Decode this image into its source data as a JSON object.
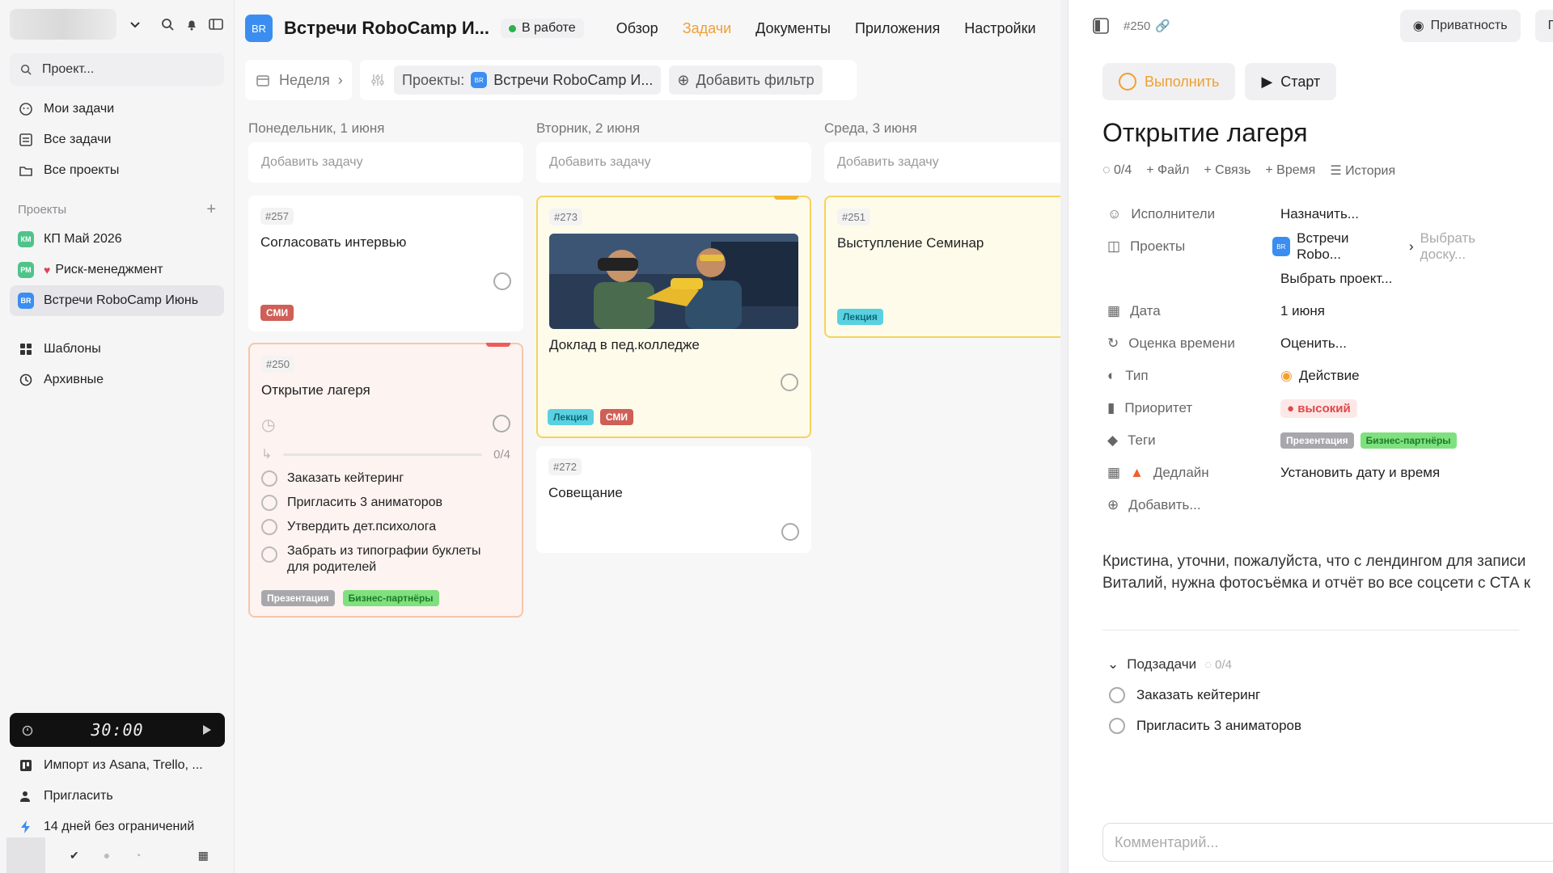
{
  "sidebar": {
    "search_placeholder": "Проект...",
    "nav": [
      {
        "label": "Мои задачи"
      },
      {
        "label": "Все задачи"
      },
      {
        "label": "Все проекты"
      }
    ],
    "projects_header": "Проекты",
    "projects": [
      {
        "badge": "КМ",
        "label": "КП Май 2026",
        "color": "#4fc48a"
      },
      {
        "badge": "РМ",
        "label": "Риск-менеджмент",
        "color": "#4fc48a"
      },
      {
        "badge": "BR",
        "label": "Встречи RoboCamp Июнь",
        "color": "#3b8ef0"
      }
    ],
    "extra": [
      {
        "label": "Шаблоны"
      },
      {
        "label": "Архивные"
      }
    ],
    "timer": "30:00",
    "bottom": [
      {
        "label": "Импорт из Asana, Trello, ..."
      },
      {
        "label": "Пригласить"
      },
      {
        "label": "14 дней без ограничений"
      }
    ]
  },
  "header": {
    "logo": "BR",
    "title": "Встречи RoboCamp И...",
    "status": "В работе",
    "tabs": [
      "Обзор",
      "Задачи",
      "Документы",
      "Приложения",
      "Настройки"
    ],
    "active_tab": "Задачи"
  },
  "filters": {
    "period": "Неделя",
    "projects_label": "Проекты:",
    "project_chip": "Встречи RoboCamp И...",
    "add_filter": "Добавить фильтр"
  },
  "board": {
    "add_task": "Добавить задачу",
    "columns": [
      {
        "title": "Понедельник, 1 июня",
        "cards": [
          {
            "num": "#257",
            "title": "Согласовать интервью",
            "tags": [
              "СМИ"
            ]
          },
          {
            "num": "#250",
            "title": "Открытие лагеря",
            "progress": "0/4",
            "subtasks": [
              "Заказать кейтеринг",
              "Пригласить 3 аниматоров",
              "Утвердить дет.психолога",
              "Забрать из типографии буклеты для родителей"
            ],
            "tags": [
              "Презентация",
              "Бизнес-партнёры"
            ]
          }
        ]
      },
      {
        "title": "Вторник, 2 июня",
        "cards": [
          {
            "num": "#273",
            "title": "Доклад в пед.колледже",
            "tags": [
              "Лекция",
              "СМИ"
            ]
          },
          {
            "num": "#272",
            "title": "Совещание"
          }
        ]
      },
      {
        "title": "Среда, 3 июня",
        "cards": [
          {
            "num": "#251",
            "title": "Выступление Семинар",
            "tags": [
              "Лекция"
            ]
          }
        ]
      }
    ]
  },
  "panel": {
    "num": "#250",
    "privacy": "Приватность",
    "cut_btn": "По",
    "complete": "Выполнить",
    "start": "Старт",
    "title": "Открытие лагеря",
    "meta": {
      "progress": "0/4",
      "file": "Файл",
      "link": "Связь",
      "time": "Время",
      "history": "История"
    },
    "props": {
      "assignees": {
        "k": "Исполнители",
        "v": "Назначить..."
      },
      "projects": {
        "k": "Проекты",
        "v": "Встречи Robo...",
        "board": "Выбрать доску...",
        "pick": "Выбрать проект..."
      },
      "date": {
        "k": "Дата",
        "v": "1 июня"
      },
      "estimate": {
        "k": "Оценка времени",
        "v": "Оценить..."
      },
      "type": {
        "k": "Тип",
        "v": "Действие"
      },
      "priority": {
        "k": "Приоритет",
        "v": "высокий"
      },
      "tags": {
        "k": "Теги",
        "v": [
          "Презентация",
          "Бизнес-партнёры"
        ]
      },
      "deadline": {
        "k": "Дедлайн",
        "v": "Установить дату и время"
      },
      "add": "Добавить..."
    },
    "description": [
      "Кристина, уточни, пожалуйста, что с лендингом для записи",
      "Виталий, нужна фотосъёмка и отчёт во все соцсети с СТА к"
    ],
    "subtasks_header": "Подзадачи",
    "subtasks_progress": "0/4",
    "subtasks": [
      "Заказать кейтеринг",
      "Пригласить 3 аниматоров"
    ],
    "comment_placeholder": "Комментарий..."
  }
}
